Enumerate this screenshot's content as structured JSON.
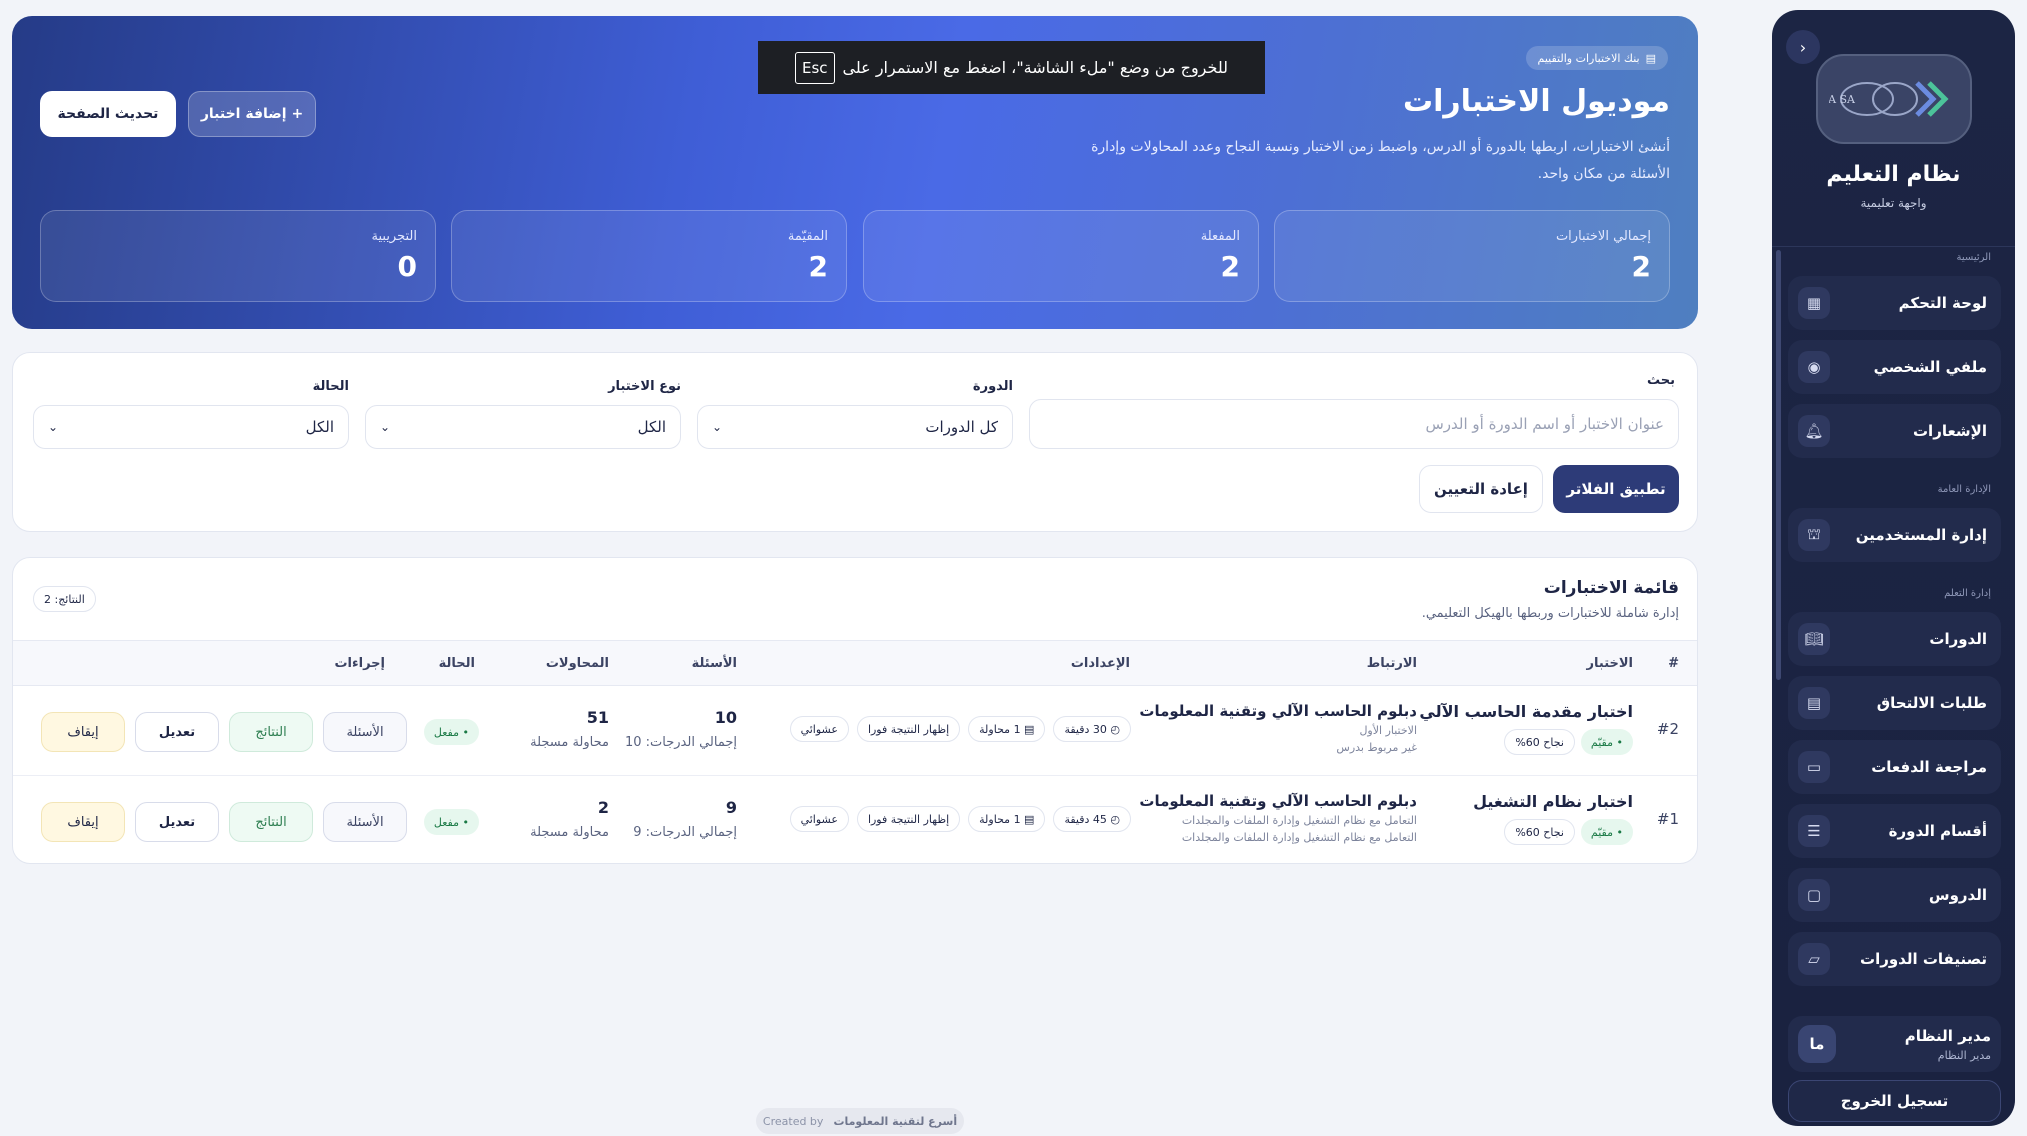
{
  "esc_notice": {
    "text": "للخروج من وضع \"ملء الشاشة\"، اضغط مع الاستمرار على",
    "key": "Esc"
  },
  "sidebar": {
    "title": "نظام التعليم",
    "subtitle": "واجهة تعليمية",
    "logo_text": "ASKA SA",
    "sections": {
      "main": "الرئيسية",
      "general": "الإدارة العامة",
      "learning": "إدارة التعلم"
    },
    "items": [
      {
        "label": "لوحة التحكم",
        "icon": "dashboard-icon"
      },
      {
        "label": "ملفي الشخصي",
        "icon": "user-circle-icon"
      },
      {
        "label": "الإشعارات",
        "icon": "bell-icon"
      },
      {
        "label": "إدارة المستخدمين",
        "icon": "users-icon"
      },
      {
        "label": "الدورات",
        "icon": "book-icon"
      },
      {
        "label": "طلبات الالتحاق",
        "icon": "document-icon"
      },
      {
        "label": "مراجعة الدفعات",
        "icon": "wallet-icon"
      },
      {
        "label": "أقسام الدورة",
        "icon": "list-icon"
      },
      {
        "label": "الدروس",
        "icon": "briefcase-icon"
      },
      {
        "label": "تصنيفات الدورات",
        "icon": "folder-icon"
      }
    ],
    "user": {
      "initials": "ما",
      "name": "مدير النظام",
      "role": "مدير النظام"
    },
    "logout": "تسجيل الخروج"
  },
  "hero": {
    "badge": "بنك الاختبارات والتقييم",
    "title": "موديول الاختبارات",
    "description": "أنشئ الاختبارات، اربطها بالدورة أو الدرس، واضبط زمن الاختبار ونسبة النجاح وعدد المحاولات وإدارة الأسئلة من مكان واحد.",
    "refresh": "تحديث الصفحة",
    "add": "+ إضافة اختبار",
    "stats": [
      {
        "label": "إجمالي الاختبارات",
        "value": "2"
      },
      {
        "label": "المفعلة",
        "value": "2"
      },
      {
        "label": "المقيّمة",
        "value": "2"
      },
      {
        "label": "التجريبية",
        "value": "0"
      }
    ]
  },
  "filters": {
    "search_label": "بحث",
    "search_placeholder": "عنوان الاختبار أو اسم الدورة أو الدرس",
    "course_label": "الدورة",
    "course_value": "كل الدورات",
    "type_label": "نوع الاختبار",
    "type_value": "الكل",
    "status_label": "الحالة",
    "status_value": "الكل",
    "apply": "تطبيق الفلاتر",
    "reset": "إعادة التعيين"
  },
  "list": {
    "title": "قائمة الاختبارات",
    "subtitle": "إدارة شاملة للاختبارات وربطها بالهيكل التعليمي.",
    "count": "النتائج: 2",
    "columns": {
      "num": "#",
      "quiz": "الاختبار",
      "link": "الارتباط",
      "settings": "الإعدادات",
      "questions": "الأسئلة",
      "attempts": "المحاولات",
      "status": "الحالة",
      "actions": "إجراءات"
    },
    "rows": [
      {
        "num": "#2",
        "name": "اختبار مقدمة الحاسب الآلي",
        "type": "• مقيّم",
        "pass": "نجاح 60%",
        "course": "دبلوم الحاسب الآلي وتقنية المعلومات",
        "sub1": "الاختبار الأول",
        "sub2": "غير مربوط بدرس",
        "duration": "30 دقيقة",
        "attempts_setting": "1 محاولة",
        "show_result": "إظهار النتيجة فورا",
        "random": "عشوائي",
        "questions": "10",
        "degrees": "إجمالي الدرجات: 10",
        "attempts": "51",
        "attempts_sub": "محاولة مسجلة",
        "status": "• مفعل",
        "a_questions": "الأسئلة",
        "a_results": "النتائج",
        "a_edit": "تعديل",
        "a_stop": "إيقاف"
      },
      {
        "num": "#1",
        "name": "اختبار نظام التشغيل",
        "type": "• مقيّم",
        "pass": "نجاح 60%",
        "course": "دبلوم الحاسب الآلي وتقنية المعلومات",
        "sub1": "التعامل مع نظام التشغيل وإدارة الملفات والمجلدات",
        "sub2": "التعامل مع نظام التشغيل وإدارة الملفات والمجلدات",
        "duration": "45 دقيقة",
        "attempts_setting": "1 محاولة",
        "show_result": "إظهار النتيجة فورا",
        "random": "عشوائي",
        "questions": "9",
        "degrees": "إجمالي الدرجات: 9",
        "attempts": "2",
        "attempts_sub": "محاولة مسجلة",
        "status": "• مفعل",
        "a_questions": "الأسئلة",
        "a_results": "النتائج",
        "a_edit": "تعديل",
        "a_stop": "إيقاف"
      }
    ]
  },
  "footer": {
    "created": "Created by",
    "brand": "أسرع لتقنية المعلومات"
  }
}
